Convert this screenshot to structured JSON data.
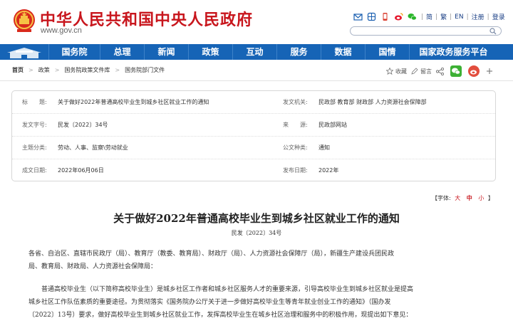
{
  "header": {
    "site_title": "中华人民共和国中央人民政府",
    "site_url": "www.gov.cn",
    "lang_simplified": "简",
    "lang_traditional": "繁",
    "lang_en": "EN",
    "register": "注册",
    "login": "登录",
    "search_placeholder": ""
  },
  "nav": {
    "items": [
      "国务院",
      "总理",
      "新闻",
      "政策",
      "互动",
      "服务",
      "数据",
      "国情",
      "国家政务服务平台"
    ]
  },
  "breadcrumb": {
    "items": [
      "首页",
      "政策",
      "国务院政策文件库",
      "国务院部门文件"
    ],
    "collect": "收藏",
    "comment": "留言"
  },
  "info": {
    "title_label": "标　　题:",
    "title_value": "关于做好2022年普通高校毕业生到城乡社区就业工作的通知",
    "issuer_label": "发文机关:",
    "issuer_value": "民政部  教育部  财政部  人力资源社会保障部",
    "docno_label": "发文字号:",
    "docno_value": "民发〔2022〕34号",
    "source_label": "来　　源:",
    "source_value": "民政部网站",
    "subject_label": "主题分类:",
    "subject_value": "劳动、人事、监察\\劳动就业",
    "type_label": "公文种类:",
    "type_value": "通知",
    "written_label": "成文日期:",
    "written_value": "2022年06月06日",
    "publish_label": "发布日期:",
    "publish_value": "2022年"
  },
  "font_size": {
    "label": "【字体:",
    "large": "大",
    "medium": "中",
    "small": "小",
    "close": "】"
  },
  "article": {
    "title": "关于做好2022年普通高校毕业生到城乡社区就业工作的通知",
    "doc_no": "民发〔2022〕34号",
    "p1_l1": "各省、自治区、直辖市民政厅（局）、教育厅（教委、教育局）、财政厅（局）、人力资源社会保障厅（局），新疆生产建设兵团民政",
    "p1_l2": "局、教育局、财政局、人力资源社会保障局：",
    "p2_l1": "　　普通高校毕业生（以下简称高校毕业生）是城乡社区工作者和城乡社区服务人才的重要来源，引导高校毕业生到城乡社区就业是提高",
    "p2_l2": "城乡社区工作队伍素质的重要途径。为贯彻落实《国务院办公厅关于进一步做好高校毕业生等青年就业创业工作的通知》（国办发",
    "p2_l3": "〔2022〕13号）要求，做好高校毕业生到城乡社区就业工作，发挥高校毕业生在城乡社区治理和服务中的积极作用，现提出如下意见："
  },
  "colors": {
    "brand_red": "#c8161d",
    "nav_blue": "#1664b6"
  }
}
